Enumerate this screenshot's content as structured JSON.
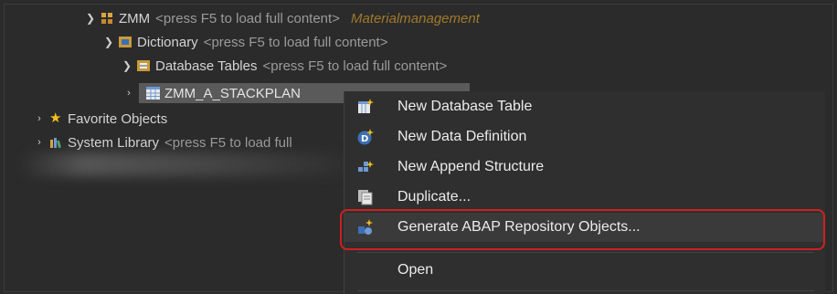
{
  "tree": {
    "zmm": {
      "label": "ZMM",
      "hint": "<press F5 to load full content>",
      "desc": "Materialmanagement"
    },
    "dictionary": {
      "label": "Dictionary",
      "hint": "<press F5 to load full content>"
    },
    "database_tables": {
      "label": "Database Tables",
      "hint": "<press F5 to load full content>"
    },
    "selected_table": {
      "label": "ZMM_A_STACKPLAN"
    },
    "favorite_objects": {
      "label": "Favorite Objects"
    },
    "system_library": {
      "label": "System Library",
      "hint": "<press F5 to load full"
    }
  },
  "context_menu": {
    "items": [
      {
        "label": "New Database Table",
        "icon": "new-table-icon"
      },
      {
        "label": "New Data Definition",
        "icon": "data-definition-icon"
      },
      {
        "label": "New Append Structure",
        "icon": "append-structure-icon"
      },
      {
        "label": "Duplicate...",
        "icon": "duplicate-icon"
      },
      {
        "label": "Generate ABAP Repository Objects...",
        "icon": "generate-icon"
      },
      {
        "label": "Open",
        "icon": ""
      }
    ]
  },
  "colors": {
    "background": "#2b2b2b",
    "highlight_border": "#d02020",
    "package_desc": "#a07a2a"
  }
}
